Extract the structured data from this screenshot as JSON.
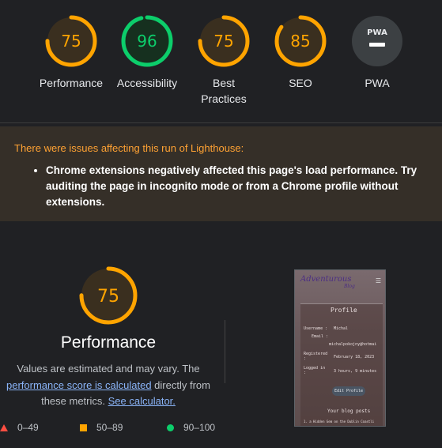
{
  "colors": {
    "average": "#ffa400",
    "good": "#0cce6b",
    "poor": "#ff4e42",
    "neutral": "#9aa0a6",
    "warning_text": "#ffa233",
    "link": "#8ab4f8"
  },
  "categories": [
    {
      "id": "performance",
      "score": "75",
      "label": "Performance",
      "rating": "average",
      "fraction": 0.75
    },
    {
      "id": "accessibility",
      "score": "96",
      "label": "Accessibility",
      "rating": "good",
      "fraction": 0.96
    },
    {
      "id": "best-practices",
      "score": "75",
      "label": "Best Practices",
      "rating": "average",
      "fraction": 0.75
    },
    {
      "id": "seo",
      "score": "85",
      "label": "SEO",
      "rating": "average",
      "fraction": 0.85
    },
    {
      "id": "pwa",
      "score": "",
      "label": "PWA",
      "rating": "neutral",
      "badge_text": "PWA",
      "icon": "pwa-badge-icon"
    }
  ],
  "warning": {
    "title": "There were issues affecting this run of Lighthouse:",
    "items": [
      "Chrome extensions negatively affected this page's load performance. Try auditing the page in incognito mode or from a Chrome profile without extensions."
    ]
  },
  "performance": {
    "score": "75",
    "fraction": 0.75,
    "title": "Performance",
    "desc_prefix": "Values are estimated and may vary. The",
    "link1": "performance score is calculated",
    "desc_middle": "directly from these metrics.",
    "link2": "See calculator."
  },
  "legend": [
    {
      "shape": "triangle",
      "range": "0–49"
    },
    {
      "shape": "square",
      "range": "50–89"
    },
    {
      "shape": "circle",
      "range": "90–100"
    }
  ],
  "screenshot": {
    "brand": "Adventurous",
    "brand_sub": "Blog",
    "menu_icon": "hamburger-icon",
    "card_title": "Profile",
    "username_label": "Username :",
    "username_value": "Michal",
    "email_label": "Email :",
    "email_value": "michalpokojny@hotmai",
    "registered_label": "Registered :",
    "registered_value": "February 18, 2023",
    "logged_label": "Logged in :",
    "logged_value": "3 hours, 9 minutes",
    "edit_button": "Edit Profile",
    "posts_title": "Your blog posts",
    "post_1": "1. a Hidden Gem on the Dublin Coastli"
  }
}
